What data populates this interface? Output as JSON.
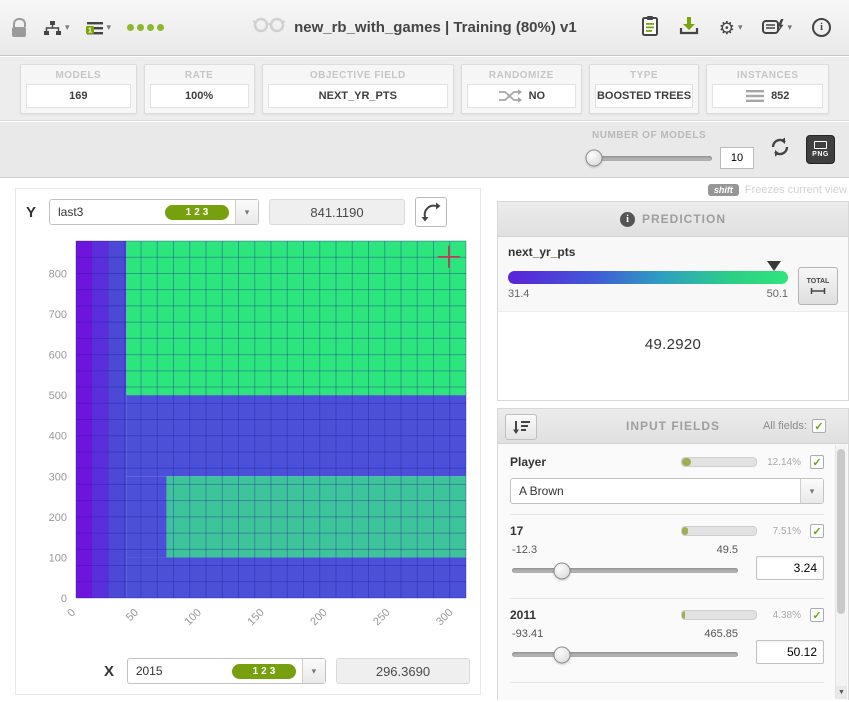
{
  "icons": {
    "caret_down": "▾",
    "check": "✓",
    "gear": "⚙",
    "info": "i",
    "scroll_down": "▼"
  },
  "topbar": {
    "title": "new_rb_with_games | Training (80%) v1"
  },
  "stats": [
    {
      "label": "MODELS",
      "value": "169"
    },
    {
      "label": "RATE",
      "value": "100%"
    },
    {
      "label": "OBJECTIVE FIELD",
      "value": "NEXT_YR_PTS"
    },
    {
      "label": "RANDOMIZE",
      "value": "NO"
    },
    {
      "label": "TYPE",
      "value": "BOOSTED TREES"
    },
    {
      "label": "INSTANCES",
      "value": "852"
    }
  ],
  "models_control": {
    "label": "NUMBER OF MODELS",
    "value": "10",
    "export": "PNG",
    "handle_pct": 2
  },
  "hint": {
    "key": "shift",
    "text": "Freezes current view"
  },
  "axes": {
    "y": {
      "letter": "Y",
      "field": "last3",
      "badge": "123",
      "value": "841.1190"
    },
    "x": {
      "letter": "X",
      "field": "2015",
      "badge": "123",
      "value": "296.3690"
    }
  },
  "prediction": {
    "header": "PREDICTION",
    "field": "next_yr_pts",
    "min": "31.4",
    "max": "50.1",
    "value": "49.2920",
    "total_label": "TOTAL",
    "marker_pct": 95
  },
  "input_fields": {
    "header": "INPUT FIELDS",
    "all_fields_label": "All fields:",
    "fields": [
      {
        "name": "Player",
        "importance_label": "12.14%",
        "importance_pct": 12.14,
        "control": "select",
        "selected": "A Brown"
      },
      {
        "name": "17",
        "importance_label": "7.51%",
        "importance_pct": 7.51,
        "control": "slider",
        "min": "-12.3",
        "max": "49.5",
        "value": "3.24",
        "handle_pct": 22
      },
      {
        "name": "2011",
        "importance_label": "4.38%",
        "importance_pct": 4.38,
        "control": "slider",
        "min": "-93.41",
        "max": "465.85",
        "value": "50.12",
        "handle_pct": 22
      }
    ]
  },
  "chart_data": {
    "type": "heatmap",
    "x_field": "2015",
    "y_field": "last3",
    "x_range": [
      0,
      310
    ],
    "y_range": [
      0,
      880
    ],
    "x_ticks": [
      0,
      50,
      100,
      150,
      200,
      250,
      300
    ],
    "y_ticks": [
      0,
      100,
      200,
      300,
      400,
      500,
      600,
      700,
      800
    ],
    "grid_step_x": 12.9167,
    "grid_step_y": 40,
    "grid_color": "rgba(30,30,150,0.35)",
    "regions": [
      {
        "x0": 0,
        "x1": 13,
        "y0": 0,
        "y1": 880,
        "color": "#6d15dd"
      },
      {
        "x0": 13,
        "x1": 26,
        "y0": 0,
        "y1": 880,
        "color": "#5a2fdb"
      },
      {
        "x0": 26,
        "x1": 40,
        "y0": 0,
        "y1": 880,
        "color": "#4b49d6"
      },
      {
        "x0": 40,
        "x1": 310,
        "y0": 500,
        "y1": 880,
        "color": "#2de57d"
      },
      {
        "x0": 40,
        "x1": 310,
        "y0": 300,
        "y1": 500,
        "color": "#4b50d8"
      },
      {
        "x0": 40,
        "x1": 72,
        "y0": 100,
        "y1": 300,
        "color": "#4b50d8"
      },
      {
        "x0": 72,
        "x1": 310,
        "y0": 100,
        "y1": 300,
        "color": "#3ec49a"
      },
      {
        "x0": 40,
        "x1": 310,
        "y0": 0,
        "y1": 100,
        "color": "#4b50d8"
      }
    ],
    "crosshair": {
      "x": 296.369,
      "y": 841.119,
      "color": "#cc3355"
    }
  }
}
